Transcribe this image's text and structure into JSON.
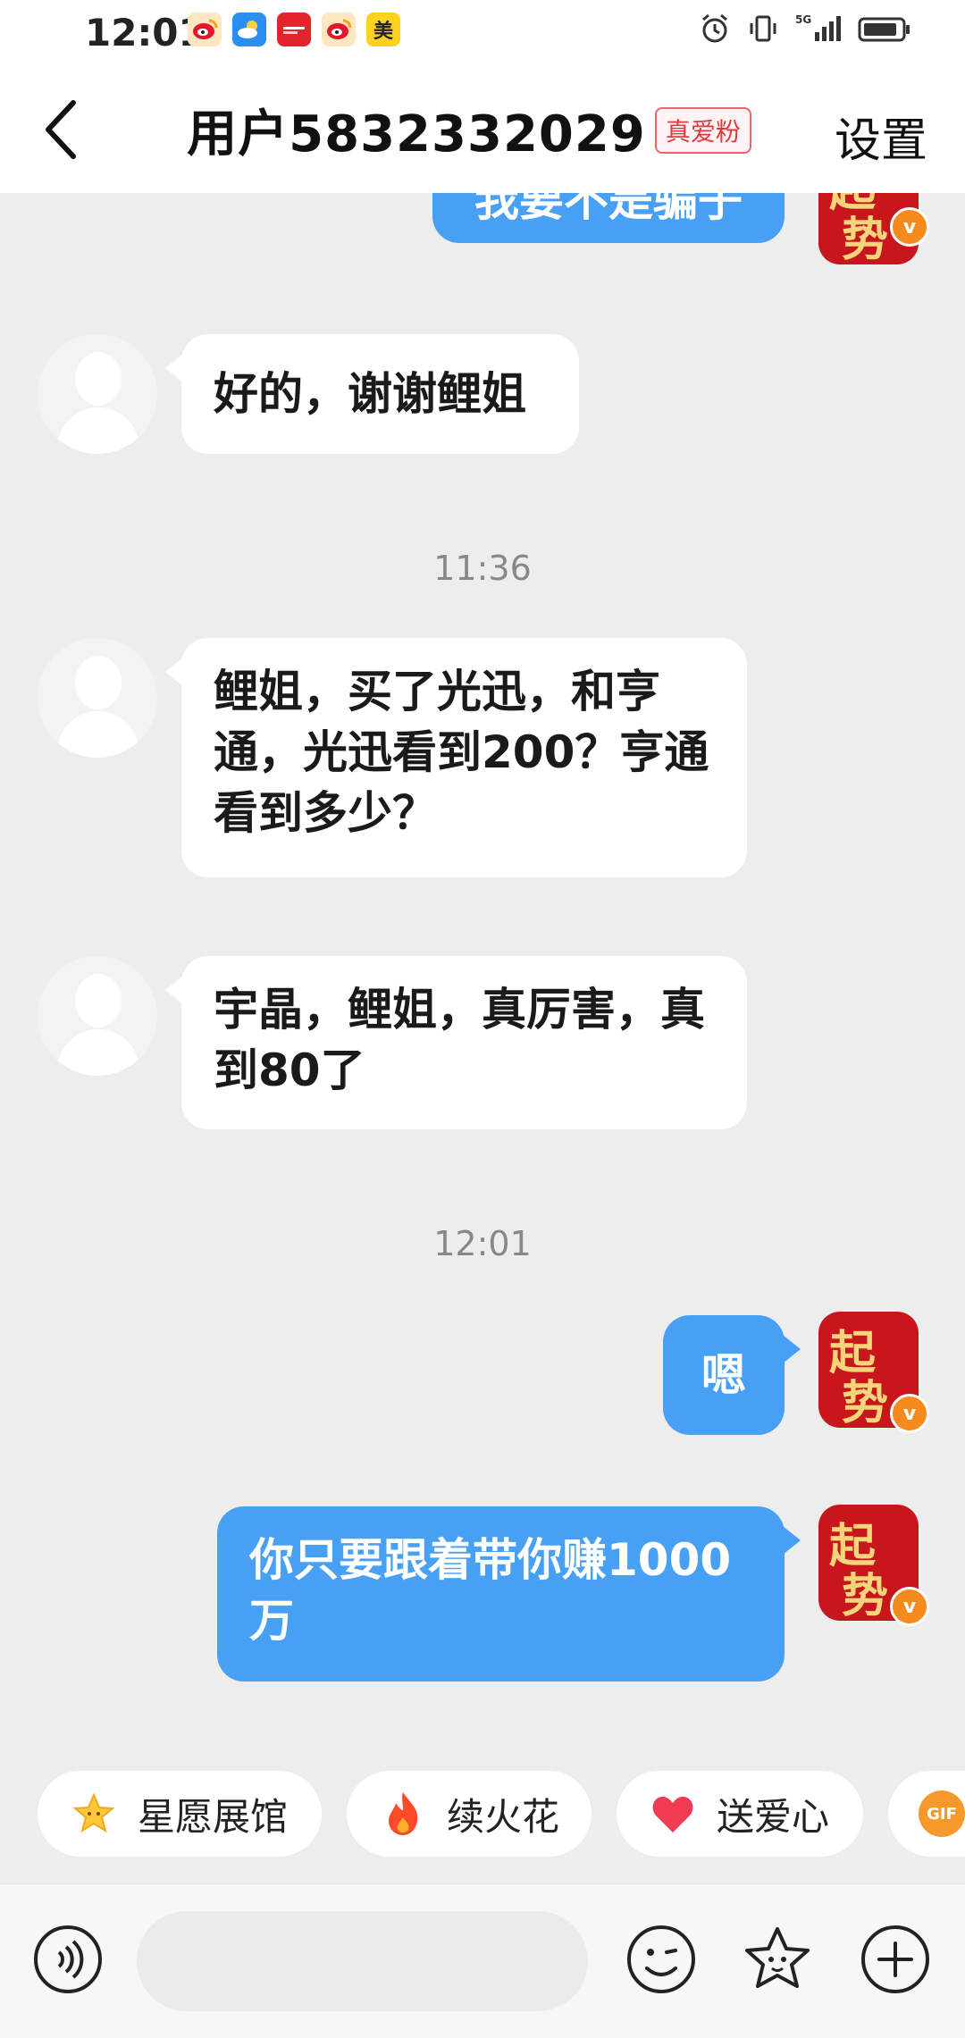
{
  "status_bar": {
    "time": "12:01",
    "apps": [
      {
        "name": "weibo-app-icon",
        "label": "",
        "color": "#f7d13e"
      },
      {
        "name": "weather-app-icon",
        "label": "",
        "color": "#2a8ff0"
      },
      {
        "name": "news-app-icon",
        "label": "",
        "color": "#e2252b"
      },
      {
        "name": "weibo-app-icon-2",
        "label": "",
        "color": "#f7d13e"
      },
      {
        "name": "meituan-app-icon",
        "label": "美",
        "color": "#ffd21f"
      }
    ],
    "network": "5G"
  },
  "header": {
    "title": "用户5832332029",
    "badge": "真爱粉",
    "settings": "设置"
  },
  "messages": [
    {
      "side": "out",
      "text": "我要不是骗子",
      "partial": true
    },
    {
      "side": "in",
      "text": "好的，谢谢鲤姐"
    },
    {
      "type": "time",
      "text": "11:36"
    },
    {
      "side": "in",
      "text": "鲤姐，买了光迅，和亨通，光迅看到200？亨通看到多少？"
    },
    {
      "side": "in",
      "text": "宇晶，鲤姐，真厉害，真到80了"
    },
    {
      "type": "time",
      "text": "12:01"
    },
    {
      "side": "out",
      "text": "嗯"
    },
    {
      "side": "out",
      "text": "你只要跟着带你赚1000万"
    }
  ],
  "brand_avatar": {
    "char1": "起",
    "char2": "势",
    "verified": "v"
  },
  "quick_actions": [
    {
      "label": "星愿展馆",
      "icon": "star-icon"
    },
    {
      "label": "续火花",
      "icon": "fire-icon"
    },
    {
      "label": "送爱心",
      "icon": "heart-icon"
    },
    {
      "label": "GIF",
      "icon": "gif-icon"
    }
  ],
  "input": {
    "placeholder": "",
    "value": ""
  },
  "colors": {
    "accent": "#48a0f5",
    "background": "#ededed",
    "badge": "#e03a40",
    "brand": "#c8161d"
  }
}
